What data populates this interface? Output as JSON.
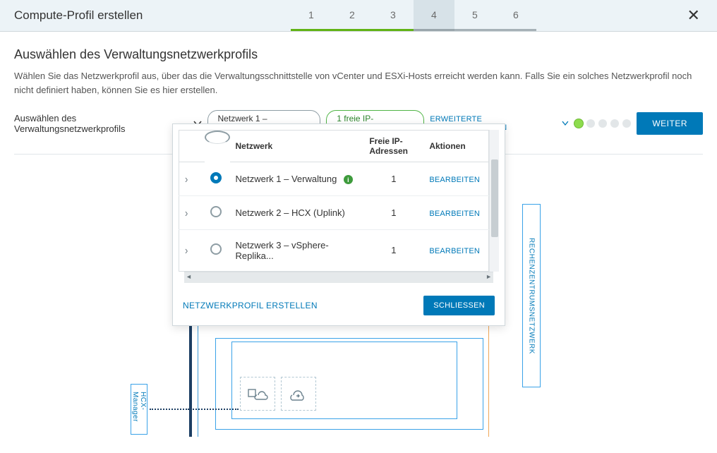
{
  "header": {
    "title": "Compute-Profil erstellen",
    "steps": [
      {
        "n": "1",
        "state": "completed"
      },
      {
        "n": "2",
        "state": "completed"
      },
      {
        "n": "3",
        "state": "completed"
      },
      {
        "n": "4",
        "state": "active"
      },
      {
        "n": "5",
        "state": "upcoming"
      },
      {
        "n": "6",
        "state": "upcoming"
      }
    ]
  },
  "section": {
    "title": "Auswählen des Verwaltungsnetzwerkprofils",
    "desc": "Wählen Sie das Netzwerkprofil aus, über das die Verwaltungsschnittstelle von vCenter und ESXi-Hosts erreicht werden kann. Falls Sie ein solches Netzwerkprofil noch nicht definiert haben, können Sie es hier erstellen."
  },
  "controls": {
    "label": "Auswählen des Verwaltungsnetzwerkprofils",
    "selected_pill": "Netzwerk 1 – Verwaltung",
    "free_pill": "1 freie IP-Adresse(n)",
    "advanced_link": "ERWEITERTE KONFIGURATIONEN",
    "continue_btn": "WEITER"
  },
  "diagram": {
    "left_label": "HCX-Manager",
    "right_label": "RECHENZENTRUMSNETZWERK"
  },
  "popup": {
    "columns": {
      "network": "Netzwerk",
      "free": "Freie IP-Adressen",
      "actions": "Aktionen"
    },
    "rows": [
      {
        "selected": true,
        "name": "Netzwerk 1 – Verwaltung",
        "note": true,
        "free": "1",
        "action": "BEARBEITEN"
      },
      {
        "selected": false,
        "name": "Netzwerk 2 – HCX (Uplink)",
        "note": false,
        "free": "1",
        "action": "BEARBEITEN"
      },
      {
        "selected": false,
        "name": "Netzwerk 3 – vSphere-Replika...",
        "note": false,
        "free": "1",
        "action": "BEARBEITEN"
      }
    ],
    "create_link": "NETZWERKPROFIL ERSTELLEN",
    "close_btn": "SCHLIESSEN"
  }
}
